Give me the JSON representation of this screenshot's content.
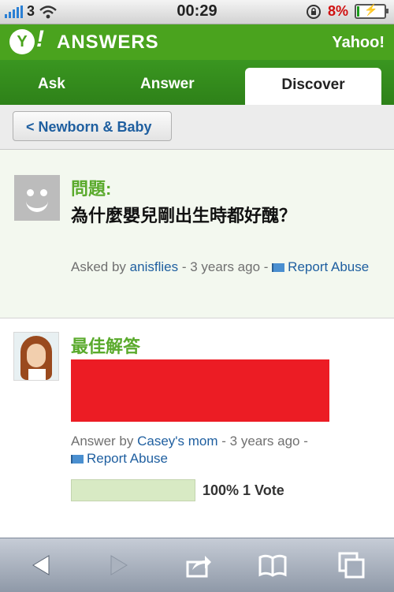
{
  "status_bar": {
    "carrier_signal": "3",
    "time": "00:29",
    "battery_percent": "8%"
  },
  "header": {
    "logo_letter": "Y",
    "logo_bang": "!",
    "brand": "ANSWERS",
    "yahoo_link": "Yahoo!"
  },
  "tabs": [
    {
      "label": "Ask",
      "active": false
    },
    {
      "label": "Answer",
      "active": false
    },
    {
      "label": "Discover",
      "active": true
    }
  ],
  "breadcrumb": {
    "label": "< Newborn & Baby"
  },
  "question": {
    "label": "問題:",
    "text": "為什麼嬰兒剛出生時都好醜？",
    "asked_prefix": "Asked by",
    "asker": "anisflies",
    "time_sep": "- 3 years ago -",
    "report": "Report Abuse"
  },
  "best_answer": {
    "label": "最佳解答",
    "answer_prefix": "Answer by",
    "answerer": "Casey's mom",
    "time_sep": "- 3 years ago -",
    "report": "Report Abuse",
    "vote_fraction": 1.0,
    "vote_text": "100% 1 Vote",
    "redacted_color": "#ec1c24"
  },
  "toolbar": {
    "icons": [
      "back-icon",
      "forward-icon",
      "share-icon",
      "bookmarks-icon",
      "pages-icon"
    ]
  },
  "colors": {
    "brand_green": "#4aa31e",
    "link_blue": "#1f5fa0",
    "label_green": "#5aaa2c"
  }
}
